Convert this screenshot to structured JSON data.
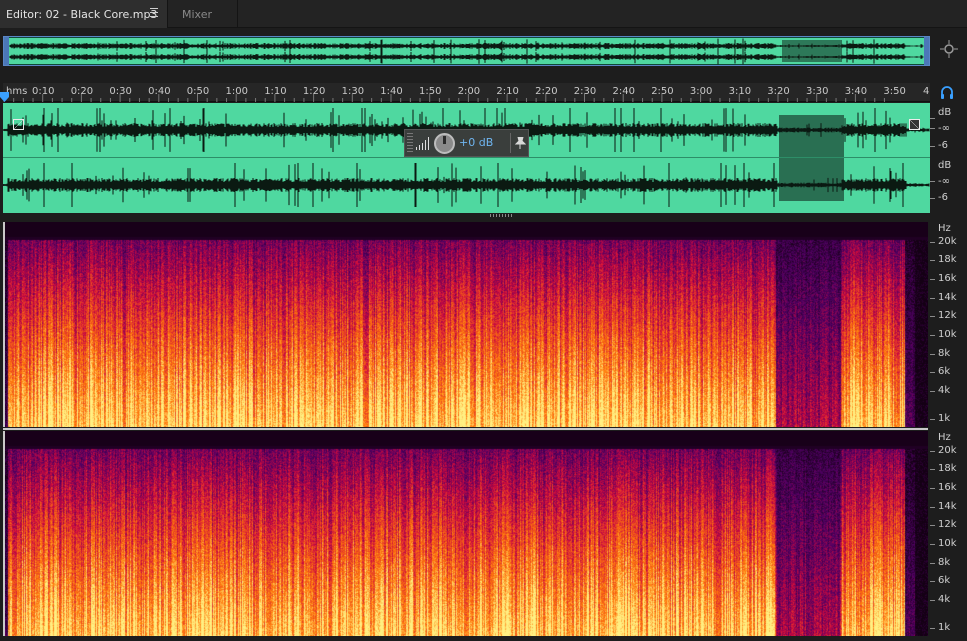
{
  "tabs": {
    "editor_label": "Editor: 02 - Black Core.mp3",
    "mixer_label": "Mixer"
  },
  "colors": {
    "waveform_fill": "#4fd8a0",
    "waveform_bg": "#0f4a3a",
    "playhead": "#3aa0ff",
    "hud_value": "#6fb5f0"
  },
  "ruler": {
    "unit_label": "hms",
    "ticks": [
      "0:10",
      "0:20",
      "0:30",
      "0:40",
      "0:50",
      "1:00",
      "1:10",
      "1:20",
      "1:30",
      "1:40",
      "1:50",
      "2:00",
      "2:10",
      "2:20",
      "2:30",
      "2:40",
      "2:50",
      "3:00",
      "3:10",
      "3:20",
      "3:30",
      "3:40",
      "3:50"
    ],
    "end_label": "4"
  },
  "hud": {
    "gain_value": "+0 dB"
  },
  "amplitude_scale": {
    "channel_1": [
      "dB",
      "-∞",
      "-6"
    ],
    "channel_2": [
      "dB",
      "-∞",
      "-6"
    ]
  },
  "frequency_scale": {
    "unit": "Hz",
    "labels": [
      "20k",
      "18k",
      "16k",
      "14k",
      "12k",
      "10k",
      "8k",
      "6k",
      "4k",
      "1k"
    ]
  },
  "icons": {
    "zoom": "zoom-navigator-icon",
    "headphones": "headphones-icon",
    "pin": "pin-icon",
    "menu": "panel-menu-icon"
  }
}
